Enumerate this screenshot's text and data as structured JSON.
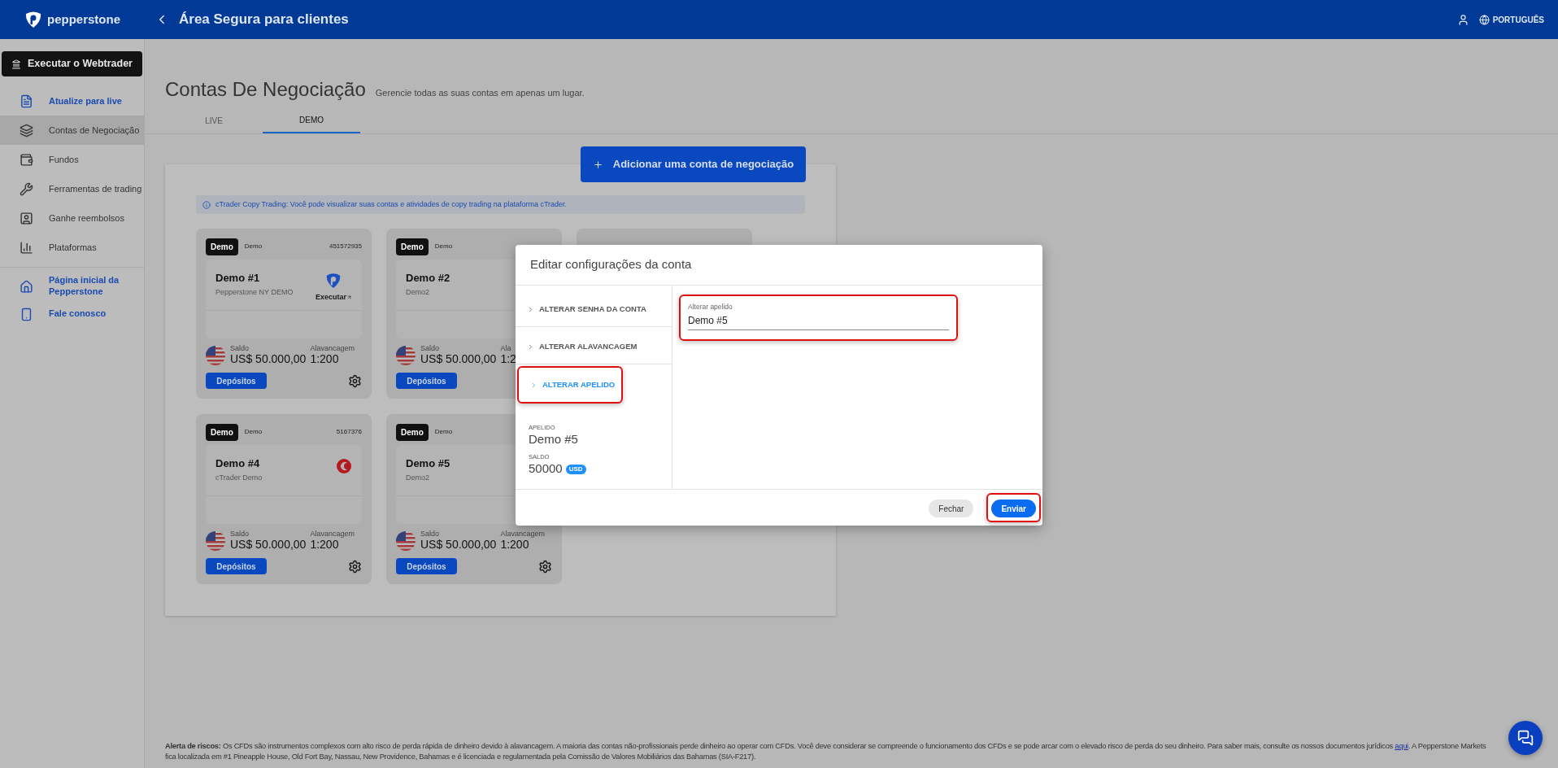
{
  "header": {
    "logo_text": "pepperstone",
    "title": "Área Segura para clientes",
    "language": "PORTUGUÊS"
  },
  "sidebar": {
    "launch_button": "Executar o Webtrader",
    "items": [
      {
        "label": "Atualize para live",
        "kind": "link",
        "selected": false
      },
      {
        "label": "Contas de Negociação",
        "kind": "plain",
        "selected": true
      },
      {
        "label": "Fundos",
        "kind": "plain",
        "selected": false
      },
      {
        "label": "Ferramentas de trading",
        "kind": "plain",
        "selected": false
      },
      {
        "label": "Ganhe reembolsos",
        "kind": "plain",
        "selected": false
      },
      {
        "label": "Plataformas",
        "kind": "plain",
        "selected": false
      }
    ],
    "footer_items": [
      {
        "label": "Página inicial da Pepperstone",
        "kind": "link"
      },
      {
        "label": "Fale conosco",
        "kind": "link"
      }
    ]
  },
  "page": {
    "title": "Contas De Negociação",
    "subtitle": "Gerencie todas as suas contas em apenas um lugar.",
    "tabs": [
      {
        "label": "LIVE",
        "selected": false
      },
      {
        "label": "DEMO",
        "selected": true
      }
    ],
    "add_button": "Adicionar uma conta de negociação",
    "info": "cTrader Copy Trading: Você pode visualizar suas contas e atividades de copy trading na plataforma cTrader.",
    "cards": [
      {
        "kind": "account",
        "badge": "Demo",
        "type": "Demo",
        "number": "451572935",
        "name": "Demo #1",
        "server": "Pepperstone NY DEMO",
        "logo": {
          "kind": "pepperstone",
          "launch": "Executar"
        },
        "balance_label": "Saldo",
        "balance": "US$ 50.000,00",
        "leverage_label": "Alavancagem",
        "leverage": "1:200",
        "deposit": "Depósitos",
        "gear": true
      },
      {
        "kind": "account",
        "badge": "Demo",
        "type": "Demo",
        "name": "Demo #2",
        "server": "Demo2",
        "balance_label": "Saldo",
        "balance": "US$ 50.000,00",
        "leverage_label": "Ala",
        "leverage": "1:2",
        "deposit": "Depósitos"
      },
      {
        "kind": "covered"
      },
      {
        "kind": "account",
        "badge": "Demo",
        "type": "Demo",
        "number": "5167376",
        "name": "Demo #4",
        "server": "cTrader Demo",
        "logo": {
          "kind": "ctrader"
        },
        "balance_label": "Saldo",
        "balance": "US$ 50.000,00",
        "leverage_label": "Alavancagem",
        "leverage": "1:200",
        "deposit": "Depósitos",
        "gear": true
      },
      {
        "kind": "account",
        "badge": "Demo",
        "type": "Demo",
        "name": "Demo #5",
        "server": "Demo2",
        "balance_label": "Saldo",
        "balance": "US$ 50.000,00",
        "leverage_label": "Alavancagem",
        "leverage": "1:200",
        "deposit": "Depósitos",
        "gear": true
      }
    ]
  },
  "modal": {
    "title": "Editar configurações da conta",
    "menu": [
      {
        "label": "ALTERAR SENHA DA CONTA",
        "selected": false,
        "highlighted": false
      },
      {
        "label": "ALTERAR ALAVANCAGEM",
        "selected": false,
        "highlighted": false
      },
      {
        "label": "ALTERAR APELIDO",
        "selected": true,
        "highlighted": true
      }
    ],
    "summary": {
      "nickname_label": "APELIDO",
      "nickname": "Demo #5",
      "balance_label": "SALDO",
      "balance": "50000",
      "currency": "USD"
    },
    "field": {
      "label": "Alterar apelido",
      "value": "Demo #5",
      "highlighted": true
    },
    "buttons": [
      {
        "label": "Fechar",
        "kind": "secondary",
        "highlighted": false
      },
      {
        "label": "Enviar",
        "kind": "primary",
        "highlighted": true
      }
    ]
  },
  "footer": {
    "text": "**Alerta de riscos:** Os CFDs são instrumentos complexos com alto risco de perda rápida de dinheiro devido à alavancagem. A maioria das contas não-profissionais perde dinheiro ao operar com CFDs. Você deve considerar se compreende o funcionamento dos CFDs e se pode arcar com o elevado risco de perda do seu dinheiro. Para saber mais, consulte os nossos documentos jurídicos ",
    "link": "aqui",
    "text_after": ". A Pepperstone Markets",
    "line2": "fica localizada em #1 Pineapple House, Old Fort Bay, Nassau, New Providence, Bahamas e é licenciada e regulamentada pela Comissão de Valores Mobiliários das Bahamas (SIA-F217)."
  }
}
